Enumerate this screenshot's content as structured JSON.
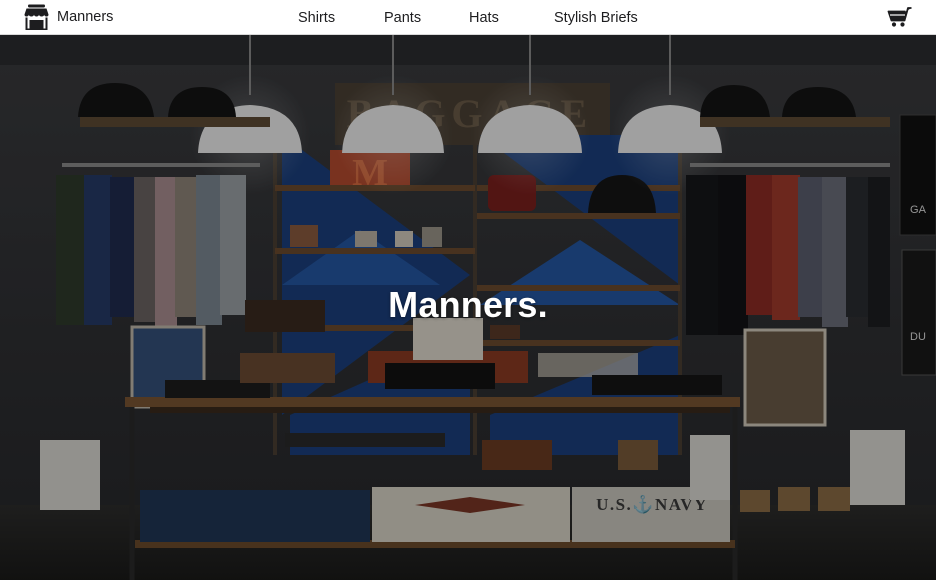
{
  "brand": {
    "name": "Manners",
    "icon": "storefront-icon"
  },
  "nav": {
    "items": [
      {
        "label": "Shirts"
      },
      {
        "label": "Pants"
      },
      {
        "label": "Hats"
      },
      {
        "label": "Stylish Briefs"
      }
    ]
  },
  "cart": {
    "icon": "shopping-cart-icon"
  },
  "hero": {
    "title": "Manners.",
    "navy_sign": "U.S.⚓NAVY"
  },
  "colors": {
    "header_bg": "#ffffff",
    "text": "#1d1d1f",
    "hero_overlay": "#000000"
  }
}
